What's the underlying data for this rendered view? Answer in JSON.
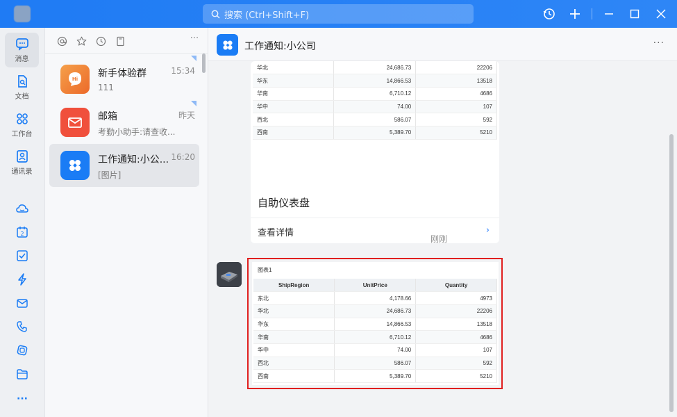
{
  "search": {
    "placeholder": "搜索 (Ctrl+Shift+F)"
  },
  "rail": {
    "items": [
      {
        "label": "消息"
      },
      {
        "label": "文档"
      },
      {
        "label": "工作台"
      },
      {
        "label": "通讯录"
      }
    ],
    "more": "···"
  },
  "conversations": [
    {
      "name": "新手体验群",
      "preview": "111",
      "time": "15:34",
      "avatar_color": "#f0853a"
    },
    {
      "name": "邮箱",
      "preview": "考勤小助手:请查收...",
      "time": "昨天",
      "avatar_color": "#f0503c"
    },
    {
      "name": "工作通知:小公...",
      "preview": "[图片]",
      "time": "16:20",
      "avatar_color": "#1a7cf5"
    }
  ],
  "chat": {
    "title": "工作通知:小公司",
    "more": "···",
    "card1": {
      "title": "自助仪表盘",
      "link": "查看详情",
      "rows": [
        {
          "region": "华北",
          "price": "24,686.73",
          "qty": "22206"
        },
        {
          "region": "华东",
          "price": "14,866.53",
          "qty": "13518"
        },
        {
          "region": "华南",
          "price": "6,710.12",
          "qty": "4686"
        },
        {
          "region": "华中",
          "price": "74.00",
          "qty": "107"
        },
        {
          "region": "西北",
          "price": "586.07",
          "qty": "592"
        },
        {
          "region": "西南",
          "price": "5,389.70",
          "qty": "5210"
        }
      ]
    },
    "timestamp": "刚刚",
    "card2": {
      "caption": "图表1",
      "headers": [
        "ShipRegion",
        "UnitPrice",
        "Quantity"
      ],
      "rows": [
        {
          "region": "东北",
          "price": "4,178.66",
          "qty": "4973"
        },
        {
          "region": "华北",
          "price": "24,686.73",
          "qty": "22206"
        },
        {
          "region": "华东",
          "price": "14,866.53",
          "qty": "13518"
        },
        {
          "region": "华南",
          "price": "6,710.12",
          "qty": "4686"
        },
        {
          "region": "华中",
          "price": "74.00",
          "qty": "107"
        },
        {
          "region": "西北",
          "price": "586.07",
          "qty": "592"
        },
        {
          "region": "西南",
          "price": "5,389.70",
          "qty": "5210"
        }
      ]
    }
  },
  "colors": {
    "accent": "#2b7fff",
    "highlight": "#e01f1f"
  }
}
